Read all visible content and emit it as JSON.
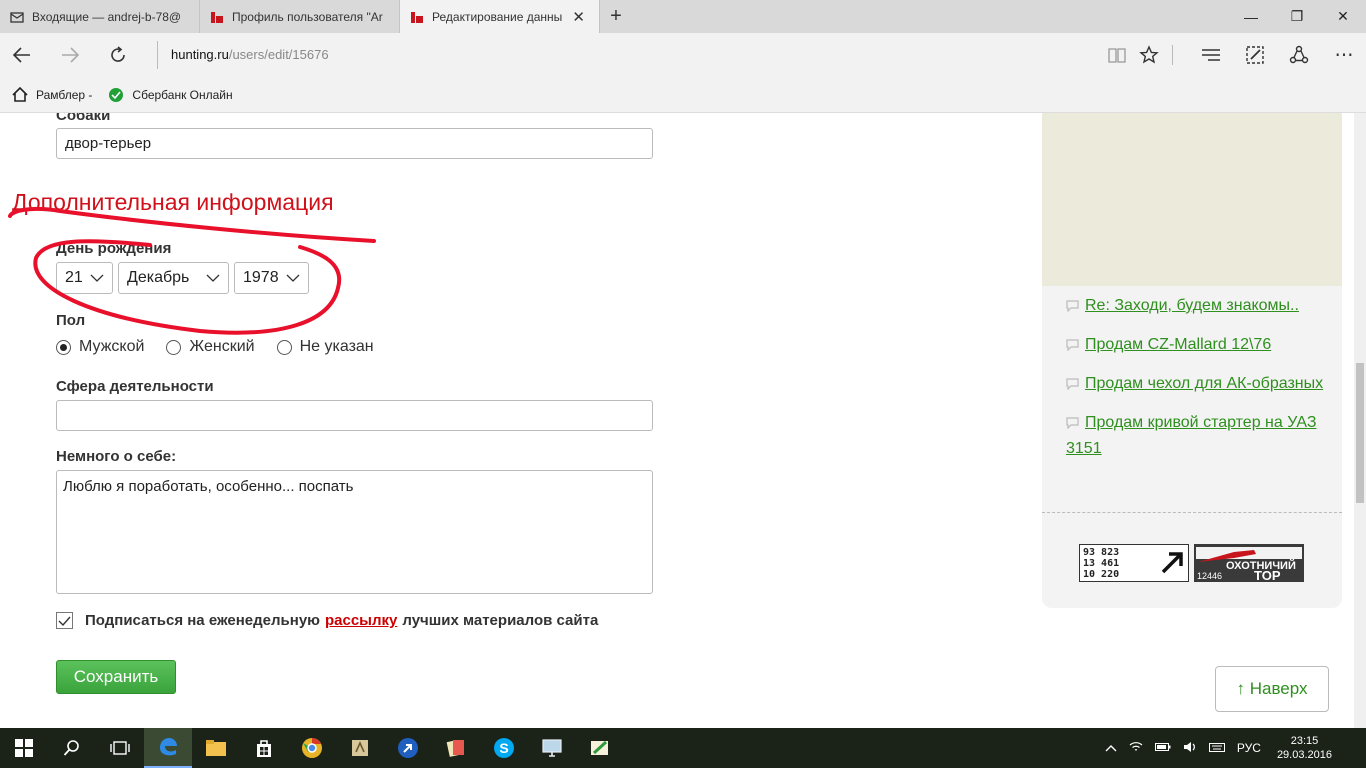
{
  "browser": {
    "tabs": [
      {
        "title": "Входящие — andrej-b-78@",
        "icon": "mail-icon",
        "active": false
      },
      {
        "title": "Профиль пользователя \"Ar",
        "icon": "site-icon",
        "active": false
      },
      {
        "title": "Редактирование данны",
        "icon": "site-icon",
        "active": true
      }
    ],
    "address": {
      "host": "hunting.ru",
      "path": "/users/edit/15676"
    },
    "favorites": [
      {
        "label": "Рамблер -",
        "icon": "home-icon"
      },
      {
        "label": "Сбербанк Онлайн",
        "icon": "sberbank-icon"
      }
    ]
  },
  "form": {
    "dogs_label": "Собаки",
    "dogs_value": "двор-терьер",
    "section_title": "Дополнительная информация",
    "birthday_label": "День рождения",
    "birthday": {
      "day": "21",
      "month": "Декабрь",
      "year": "1978"
    },
    "gender_label": "Пол",
    "gender_options": [
      {
        "label": "Мужской",
        "selected": true
      },
      {
        "label": "Женский",
        "selected": false
      },
      {
        "label": "Не указан",
        "selected": false
      }
    ],
    "occupation_label": "Сфера деятельности",
    "occupation_value": "",
    "about_label": "Немного о себе:",
    "about_value": "Люблю я поработать, особенно... поспать",
    "subscribe": {
      "checked": true,
      "before": "Подписаться на еженедельную",
      "link": "рассылку",
      "after": "лучших материалов сайта"
    },
    "save_label": "Сохранить"
  },
  "sidebar": {
    "topics": [
      "Re: Заходи, будем знакомы..",
      "Продам CZ-Mallard 12\\76",
      "Продам чехол для АК-образных",
      "Продам кривой стартер на УАЗ 3151"
    ],
    "counter1": {
      "lines": [
        "93 823",
        "13 461",
        "10 220"
      ]
    },
    "counter2": {
      "name": "ОХОТНИЧИЙ",
      "number": "12446",
      "suffix": "TOP"
    }
  },
  "to_top_label": "↑ Наверх",
  "taskbar": {
    "apps": [
      "start-icon",
      "search-icon",
      "task-view-icon",
      "edge-icon",
      "explorer-icon",
      "store-icon",
      "chrome-icon",
      "app-icon",
      "arrow-app-icon",
      "cards-icon",
      "skype-icon",
      "monitor-icon",
      "paint-icon"
    ],
    "language": "РУС",
    "time": "23:15",
    "date": "29.03.2016"
  },
  "colors": {
    "accent": "#d0101a",
    "link": "#2f8f1f",
    "save": "#4cb34c"
  }
}
